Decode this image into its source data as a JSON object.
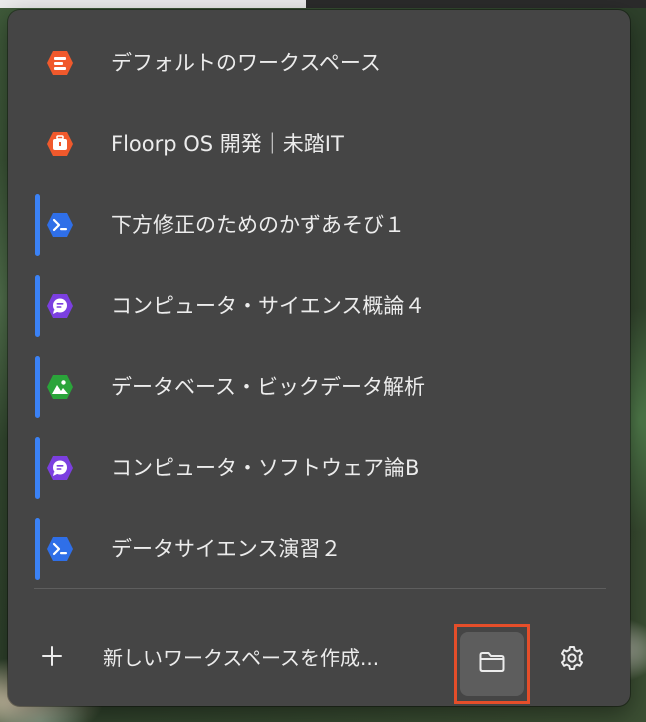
{
  "workspaces": [
    {
      "label": "デフォルトのワークスペース",
      "icon": "briefcase-list-icon",
      "color": "#f0592c",
      "active_bar": false
    },
    {
      "label": "Floorp OS 開発｜未踏IT",
      "icon": "briefcase-icon",
      "color": "#f0592c",
      "active_bar": false
    },
    {
      "label": "下方修正のためのかずあそび１",
      "icon": "terminal-icon",
      "color": "#2f6fe8",
      "active_bar": true
    },
    {
      "label": "コンピュータ・サイエンス概論４",
      "icon": "chat-bubble-icon",
      "color": "#7b3fe0",
      "active_bar": true
    },
    {
      "label": "データベース・ビックデータ解析",
      "icon": "image-icon",
      "color": "#2aa43a",
      "active_bar": true
    },
    {
      "label": "コンピュータ・ソフトウェア論B",
      "icon": "chat-bubble-icon",
      "color": "#7b3fe0",
      "active_bar": true
    },
    {
      "label": "データサイエンス演習２",
      "icon": "terminal-icon",
      "color": "#2f6fe8",
      "active_bar": true
    }
  ],
  "footer": {
    "create_label": "新しいワークスペースを作成...",
    "plus_icon": "plus-icon",
    "folder_icon": "folder-icon",
    "settings_icon": "gear-icon",
    "highlight_color": "#e54e2a"
  }
}
